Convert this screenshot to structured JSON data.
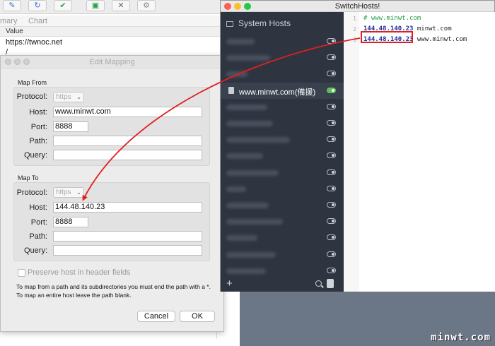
{
  "charles": {
    "toolbar_icons": [
      "pencil-icon",
      "refresh-icon",
      "check-icon",
      "basket-icon",
      "tools-icon",
      "settings-icon"
    ],
    "tabs": [
      "mary",
      "Chart"
    ],
    "table_header": "Value",
    "rows": [
      "https://twnoc.net",
      "/"
    ]
  },
  "dialog": {
    "title": "Edit Mapping",
    "map_from": {
      "section": "Map From",
      "protocol_label": "Protocol:",
      "protocol_value": "https",
      "host_label": "Host:",
      "host_value": "www.minwt.com",
      "port_label": "Port:",
      "port_value": "8888",
      "path_label": "Path:",
      "path_value": "",
      "query_label": "Query:",
      "query_value": ""
    },
    "map_to": {
      "section": "Map To",
      "protocol_label": "Protocol:",
      "protocol_value": "https",
      "host_label": "Host:",
      "host_value": "144.48.140.23",
      "port_label": "Port:",
      "port_value": "8888",
      "path_label": "Path:",
      "path_value": "",
      "query_label": "Query:",
      "query_value": ""
    },
    "preserve_host_label": "Preserve host in header fields",
    "note": "To map from a path and its subdirectories you must end the path with a *. To map an entire host leave the path blank.",
    "cancel_label": "Cancel",
    "ok_label": "OK"
  },
  "switchhosts": {
    "title": "SwitchHosts!",
    "system_hosts_label": "System Hosts",
    "active_item_label": "www.minwt.com(備援)",
    "item_count": 15,
    "active_index": 3,
    "code_lines": [
      {
        "num": "1",
        "comment": "# www.minwt.com",
        "ip": "",
        "host": ""
      },
      {
        "num": "2",
        "comment": "",
        "ip": "144.48.140.23",
        "host": "minwt.com"
      },
      {
        "num": "3",
        "comment": "",
        "ip": "144.48.140.23",
        "host": "www.minwt.com"
      }
    ]
  },
  "colors": {
    "sidebar": "#2e3440",
    "toggle_on": "#5fbf5a",
    "annotation": "#e02020"
  },
  "watermark": "minwt.com"
}
